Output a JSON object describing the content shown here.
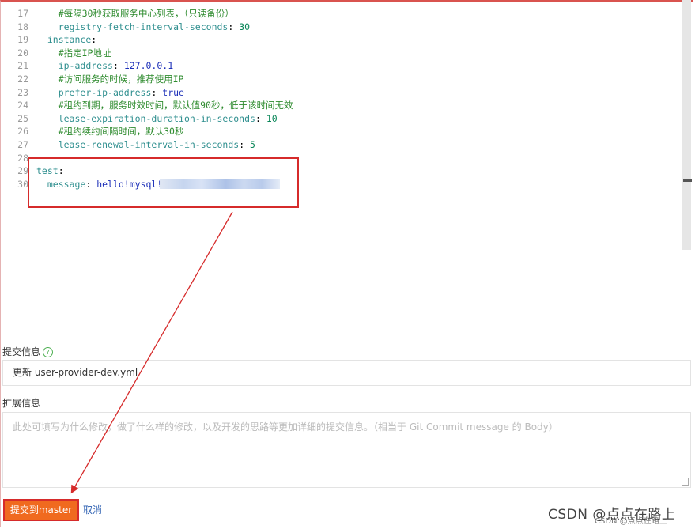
{
  "editor": {
    "lines": [
      {
        "num": "17",
        "parts": [
          {
            "t": "    ",
            "c": ""
          },
          {
            "t": "#每隔30秒获取服务中心列表，（只读备份）",
            "c": "c"
          }
        ]
      },
      {
        "num": "18",
        "parts": [
          {
            "t": "    ",
            "c": ""
          },
          {
            "t": "registry-fetch-interval-seconds",
            "c": "k"
          },
          {
            "t": ": ",
            "c": ""
          },
          {
            "t": "30",
            "c": "n"
          }
        ]
      },
      {
        "num": "19",
        "parts": [
          {
            "t": "  ",
            "c": ""
          },
          {
            "t": "instance",
            "c": "k"
          },
          {
            "t": ":",
            "c": ""
          }
        ]
      },
      {
        "num": "20",
        "parts": [
          {
            "t": "    ",
            "c": ""
          },
          {
            "t": "#指定IP地址",
            "c": "c"
          }
        ]
      },
      {
        "num": "21",
        "parts": [
          {
            "t": "    ",
            "c": ""
          },
          {
            "t": "ip-address",
            "c": "k"
          },
          {
            "t": ": ",
            "c": ""
          },
          {
            "t": "127.0.0.1",
            "c": "v"
          }
        ]
      },
      {
        "num": "22",
        "parts": [
          {
            "t": "    ",
            "c": ""
          },
          {
            "t": "#访问服务的时候，推荐使用IP",
            "c": "c"
          }
        ]
      },
      {
        "num": "23",
        "parts": [
          {
            "t": "    ",
            "c": ""
          },
          {
            "t": "prefer-ip-address",
            "c": "k"
          },
          {
            "t": ": ",
            "c": ""
          },
          {
            "t": "true",
            "c": "v"
          }
        ]
      },
      {
        "num": "24",
        "parts": [
          {
            "t": "    ",
            "c": ""
          },
          {
            "t": "#租约到期，服务时效时间，默认值90秒，低于该时间无效",
            "c": "c"
          }
        ]
      },
      {
        "num": "25",
        "parts": [
          {
            "t": "    ",
            "c": ""
          },
          {
            "t": "lease-expiration-duration-in-seconds",
            "c": "k"
          },
          {
            "t": ": ",
            "c": ""
          },
          {
            "t": "10",
            "c": "n"
          }
        ]
      },
      {
        "num": "26",
        "parts": [
          {
            "t": "    ",
            "c": ""
          },
          {
            "t": "#租约续约间隔时间，默认30秒",
            "c": "c"
          }
        ]
      },
      {
        "num": "27",
        "parts": [
          {
            "t": "    ",
            "c": ""
          },
          {
            "t": "lease-renewal-interval-in-seconds",
            "c": "k"
          },
          {
            "t": ": ",
            "c": ""
          },
          {
            "t": "5",
            "c": "n"
          }
        ]
      },
      {
        "num": "28",
        "parts": []
      },
      {
        "num": "29",
        "parts": [
          {
            "t": "test",
            "c": "k"
          },
          {
            "t": ":",
            "c": ""
          }
        ]
      },
      {
        "num": "30",
        "parts": [
          {
            "t": "  ",
            "c": ""
          },
          {
            "t": "message",
            "c": "k"
          },
          {
            "t": ": ",
            "c": ""
          },
          {
            "t": "hello!mysql!",
            "c": "txt"
          }
        ]
      }
    ]
  },
  "commit": {
    "label": "提交信息",
    "help_icon": "?",
    "value": "更新 user-provider-dev.yml"
  },
  "extended": {
    "label": "扩展信息",
    "placeholder": "此处可填写为什么修改，做了什么样的修改，以及开发的思路等更加详细的提交信息。（相当于 Git Commit message 的 Body）"
  },
  "actions": {
    "submit_label": "提交到master",
    "cancel_label": "取消"
  },
  "watermark": {
    "main": "CSDN @点点在路上",
    "sub": "CSDN @点点在路上"
  },
  "colors": {
    "accent": "#f06a1f",
    "annotation": "#d62b2b",
    "comment": "#2e8b2e",
    "key": "#2f8f8f"
  }
}
